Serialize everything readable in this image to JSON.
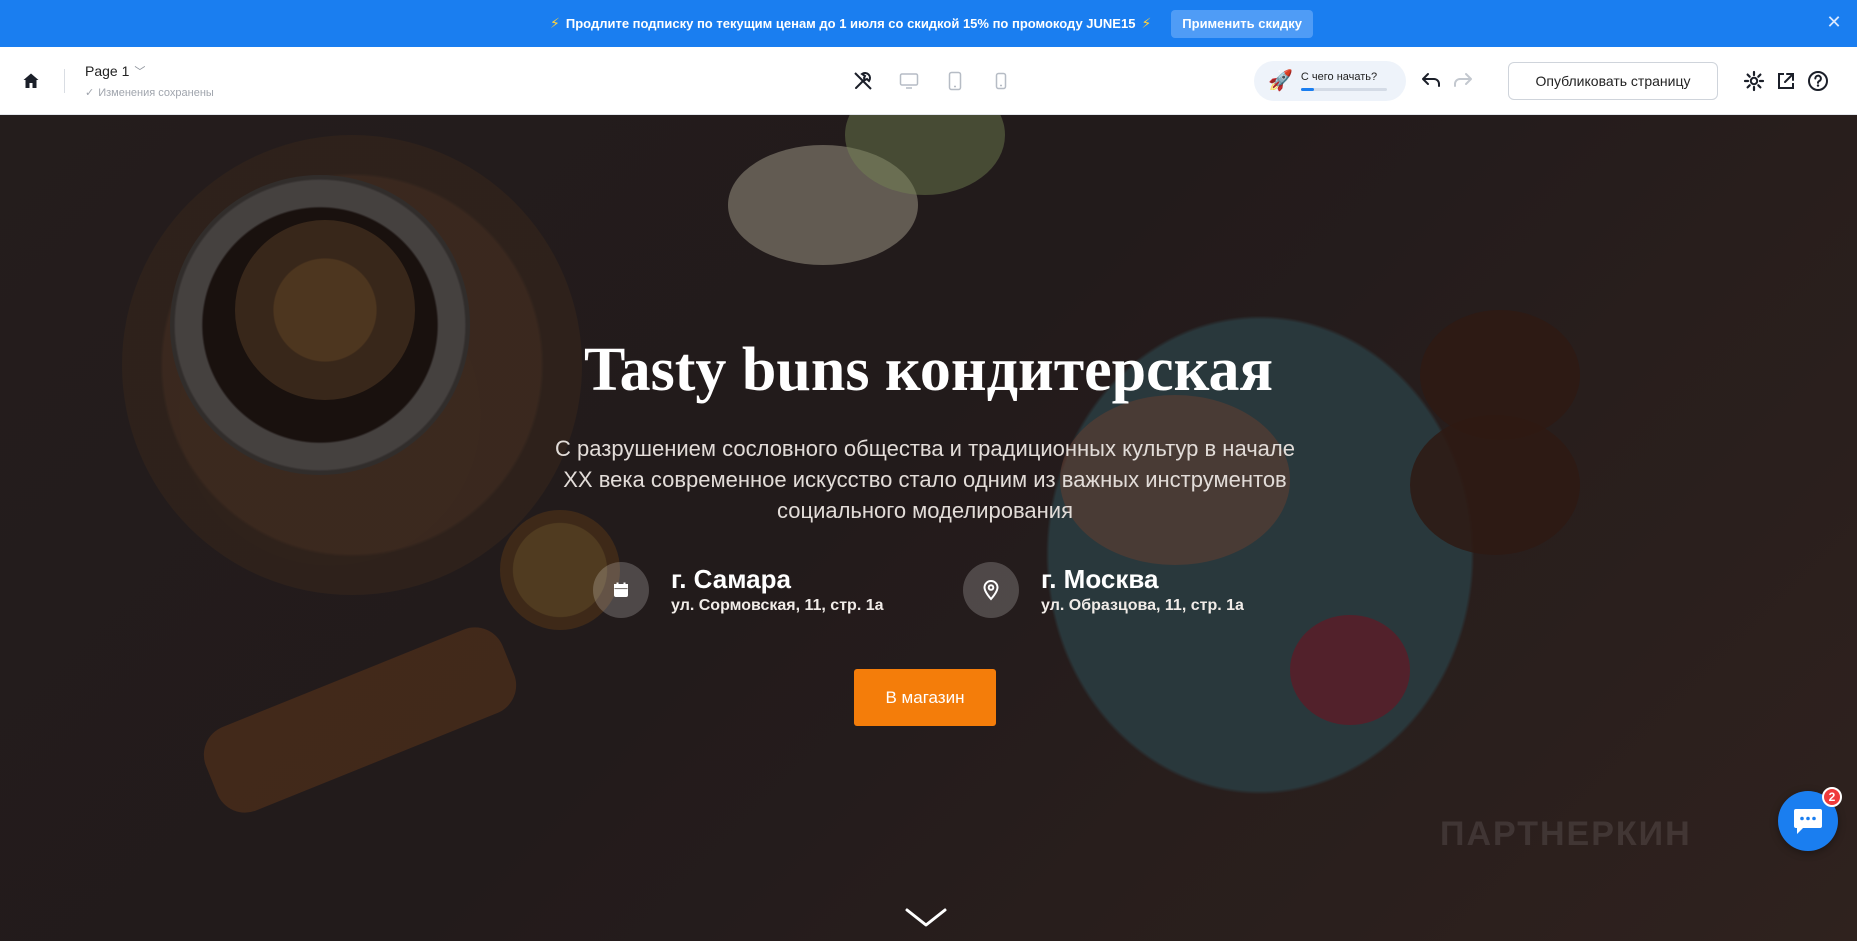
{
  "promo": {
    "text_before": "Продлите подписку по текущим ценам до 1 июля со ",
    "text_bold": "скидкой 15%",
    "text_mid": " по промокоду ",
    "code": "JUNE15",
    "bolt": "⚡",
    "apply_label": "Применить скидку",
    "close_glyph": "✕"
  },
  "toolbar": {
    "page_name": "Page 1",
    "page_chevron": "﹀",
    "saved_status": "Изменения сохранены",
    "check_glyph": "✓",
    "onboarding_label": "С чего начать?",
    "onboarding_progress": 0.15,
    "rocket_glyph": "🚀",
    "publish_label": "Опубликовать страницу"
  },
  "hero": {
    "title": "Tasty buns кондитерская",
    "description": "С разрушением сословного общества и традиционных культур в начале XX века современное искусство стало одним из важных инструментов социального моделирования",
    "locations": [
      {
        "city": "г. Самара",
        "address": "ул. Сормовская, 11, стр. 1а",
        "icon": "calendar-icon"
      },
      {
        "city": "г. Москва",
        "address": "ул. Образцова, 11, стр. 1а",
        "icon": "map-pin-icon"
      }
    ],
    "button_label": "В магазин",
    "watermark": "ПАРТНЕРКИН"
  },
  "chat": {
    "badge": "2"
  },
  "colors": {
    "promo_bg": "#1a7ef0",
    "accent_orange": "#f47d0a",
    "chat_blue": "#1a7ef0",
    "badge_red": "#ef3b3b"
  }
}
